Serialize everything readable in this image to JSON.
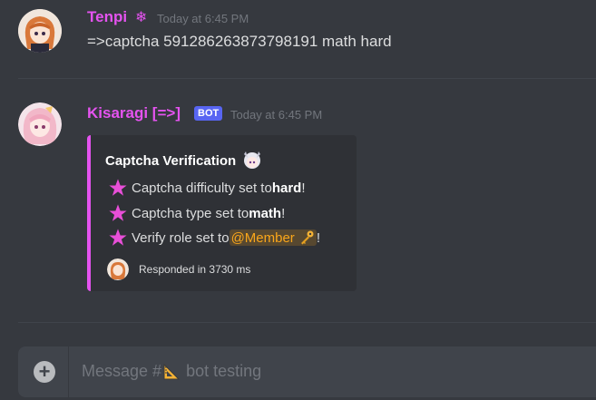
{
  "messages": [
    {
      "username": "Tenpi",
      "username_color": "#e553f0",
      "badge_icon": "snowflake-icon",
      "badge_glyph": "❄",
      "timestamp": "Today at 6:45 PM",
      "text": "=>captcha 591286263873798191 math hard"
    },
    {
      "username": "Kisaragi [=>]",
      "username_color": "#e553f0",
      "bot_tag": "BOT",
      "timestamp": "Today at 6:45 PM",
      "embed": {
        "accent_color": "#e553f0",
        "title": "Captcha Verification",
        "title_emoji": "anime-girl-emoji-icon",
        "lines": [
          {
            "icon": "pink-star-icon",
            "prefix": "Captcha difficulty set to ",
            "value": "hard",
            "suffix": "!"
          },
          {
            "icon": "pink-star-icon",
            "prefix": "Captcha type set to ",
            "value": "math",
            "suffix": "!"
          },
          {
            "icon": "pink-star-icon",
            "prefix": "Verify role set to ",
            "mention": "@Member",
            "mention_icon": "key-icon",
            "suffix": "!"
          }
        ],
        "footer": "Responded in 3730 ms"
      }
    }
  ],
  "input": {
    "placeholder_prefix": "Message #",
    "channel_icon": "triangle-ruler-icon",
    "channel_name": " bot testing"
  }
}
